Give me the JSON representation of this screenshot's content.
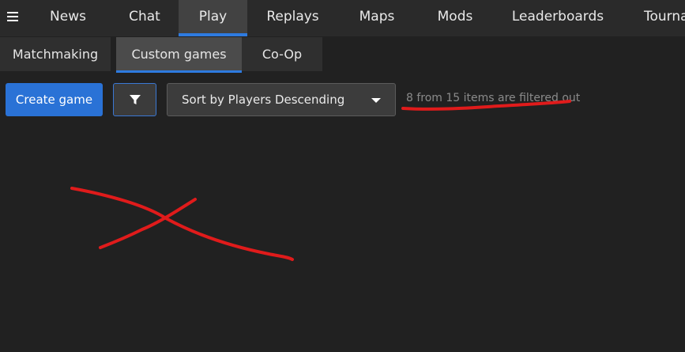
{
  "nav": {
    "tabs": [
      {
        "label": "News"
      },
      {
        "label": "Chat"
      },
      {
        "label": "Play"
      },
      {
        "label": "Replays"
      },
      {
        "label": "Maps"
      },
      {
        "label": "Mods"
      },
      {
        "label": "Leaderboards"
      },
      {
        "label": "Tourna"
      }
    ],
    "active_tab": "Play"
  },
  "subnav": {
    "tabs": [
      {
        "label": "Matchmaking"
      },
      {
        "label": "Custom games"
      },
      {
        "label": "Co-Op"
      }
    ],
    "active_tab": "Custom games"
  },
  "toolbar": {
    "create_label": "Create game",
    "sort_label": "Sort by Players Descending",
    "filter_status": "8 from 15 items are filtered out"
  },
  "colors": {
    "background": "#212121",
    "accent": "#2e7be0",
    "annotation": "#e01b1b"
  }
}
